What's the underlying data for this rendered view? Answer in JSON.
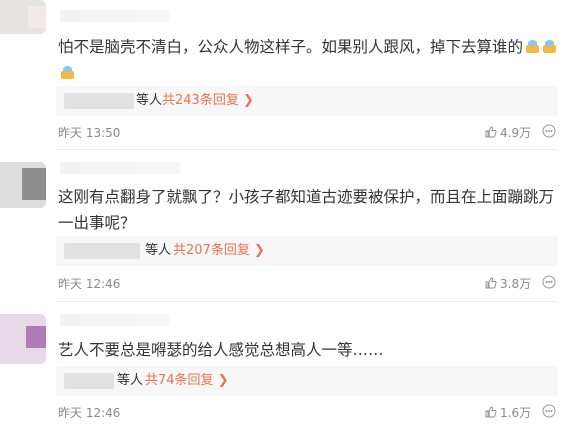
{
  "comments": [
    {
      "text": "怕不是脑壳不清白，公众人物这样子。如果别人跟风，掉下去算谁的",
      "emoji_count": 4,
      "reply_suffix": "等人",
      "reply_count": "共243条回复",
      "time": "昨天 13:50",
      "likes": "4.9万"
    },
    {
      "text": "这刚有点翻身了就飘了？小孩子都知道古迹要被保护，而且在上面蹦跳万一出事呢？",
      "reply_suffix": "等人",
      "reply_count": "共207条回复",
      "time": "昨天 12:46",
      "likes": "3.8万"
    },
    {
      "text": "艺人不要总是嘚瑟的给人感觉总想高人一等……",
      "reply_suffix": "等人",
      "reply_count": "共74条回复",
      "time": "昨天 12:46",
      "likes": "1.6万"
    }
  ],
  "icons": {
    "reply_arrow": "chevron-right-icon",
    "like": "thumbs-up-icon",
    "more": "more-icon",
    "emoji": "cake-emoji-icon"
  },
  "colors": {
    "reply_link": "#eb7350",
    "meta": "#8a8a8a",
    "reply_bg": "#f7f7f7"
  }
}
